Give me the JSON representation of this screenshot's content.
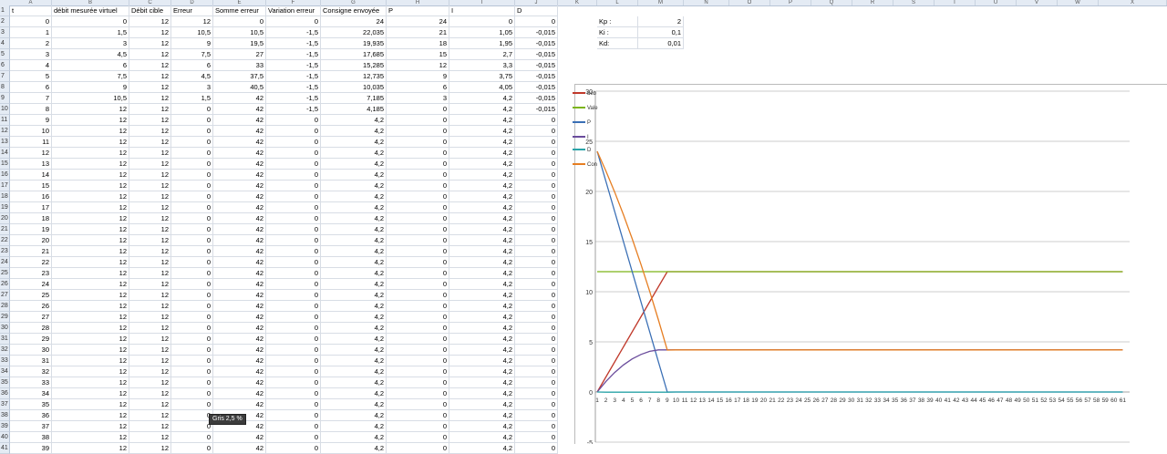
{
  "columns": [
    "A",
    "B",
    "C",
    "D",
    "E",
    "F",
    "G",
    "H",
    "I",
    "J",
    "K",
    "L",
    "M",
    "N",
    "O",
    "P",
    "Q",
    "R",
    "S",
    "T",
    "U",
    "V",
    "W",
    "X"
  ],
  "headers": [
    "t",
    "débit mesurée virtuel",
    "Débit cible",
    "Erreur",
    "Somme erreur",
    "Variation erreur",
    "Consigne envoyée",
    "P",
    "I",
    "D"
  ],
  "params": [
    {
      "label": "Kp :",
      "value": "2"
    },
    {
      "label": "Ki :",
      "value": "0,1"
    },
    {
      "label": "Kd:",
      "value": "0,01"
    }
  ],
  "row_numbers": [
    "1",
    "2",
    "3",
    "4",
    "5",
    "6",
    "7",
    "8",
    "9",
    "10",
    "11",
    "12",
    "13",
    "14",
    "15",
    "16",
    "17",
    "18",
    "19",
    "20",
    "21",
    "22",
    "23",
    "24",
    "25",
    "26",
    "27",
    "28",
    "29",
    "30",
    "31",
    "32",
    "33",
    "34",
    "35",
    "36",
    "37",
    "38",
    "39",
    "40",
    "41"
  ],
  "rows": [
    [
      "0",
      "0",
      "12",
      "12",
      "0",
      "0",
      "24",
      "24",
      "0",
      "0"
    ],
    [
      "1",
      "1,5",
      "12",
      "10,5",
      "10,5",
      "-1,5",
      "22,035",
      "21",
      "1,05",
      "-0,015"
    ],
    [
      "2",
      "3",
      "12",
      "9",
      "19,5",
      "-1,5",
      "19,935",
      "18",
      "1,95",
      "-0,015"
    ],
    [
      "3",
      "4,5",
      "12",
      "7,5",
      "27",
      "-1,5",
      "17,685",
      "15",
      "2,7",
      "-0,015"
    ],
    [
      "4",
      "6",
      "12",
      "6",
      "33",
      "-1,5",
      "15,285",
      "12",
      "3,3",
      "-0,015"
    ],
    [
      "5",
      "7,5",
      "12",
      "4,5",
      "37,5",
      "-1,5",
      "12,735",
      "9",
      "3,75",
      "-0,015"
    ],
    [
      "6",
      "9",
      "12",
      "3",
      "40,5",
      "-1,5",
      "10,035",
      "6",
      "4,05",
      "-0,015"
    ],
    [
      "7",
      "10,5",
      "12",
      "1,5",
      "42",
      "-1,5",
      "7,185",
      "3",
      "4,2",
      "-0,015"
    ],
    [
      "8",
      "12",
      "12",
      "0",
      "42",
      "-1,5",
      "4,185",
      "0",
      "4,2",
      "-0,015"
    ],
    [
      "9",
      "12",
      "12",
      "0",
      "42",
      "0",
      "4,2",
      "0",
      "4,2",
      "0"
    ],
    [
      "10",
      "12",
      "12",
      "0",
      "42",
      "0",
      "4,2",
      "0",
      "4,2",
      "0"
    ],
    [
      "11",
      "12",
      "12",
      "0",
      "42",
      "0",
      "4,2",
      "0",
      "4,2",
      "0"
    ],
    [
      "12",
      "12",
      "12",
      "0",
      "42",
      "0",
      "4,2",
      "0",
      "4,2",
      "0"
    ],
    [
      "13",
      "12",
      "12",
      "0",
      "42",
      "0",
      "4,2",
      "0",
      "4,2",
      "0"
    ],
    [
      "14",
      "12",
      "12",
      "0",
      "42",
      "0",
      "4,2",
      "0",
      "4,2",
      "0"
    ],
    [
      "15",
      "12",
      "12",
      "0",
      "42",
      "0",
      "4,2",
      "0",
      "4,2",
      "0"
    ],
    [
      "16",
      "12",
      "12",
      "0",
      "42",
      "0",
      "4,2",
      "0",
      "4,2",
      "0"
    ],
    [
      "17",
      "12",
      "12",
      "0",
      "42",
      "0",
      "4,2",
      "0",
      "4,2",
      "0"
    ],
    [
      "18",
      "12",
      "12",
      "0",
      "42",
      "0",
      "4,2",
      "0",
      "4,2",
      "0"
    ],
    [
      "19",
      "12",
      "12",
      "0",
      "42",
      "0",
      "4,2",
      "0",
      "4,2",
      "0"
    ],
    [
      "20",
      "12",
      "12",
      "0",
      "42",
      "0",
      "4,2",
      "0",
      "4,2",
      "0"
    ],
    [
      "21",
      "12",
      "12",
      "0",
      "42",
      "0",
      "4,2",
      "0",
      "4,2",
      "0"
    ],
    [
      "22",
      "12",
      "12",
      "0",
      "42",
      "0",
      "4,2",
      "0",
      "4,2",
      "0"
    ],
    [
      "23",
      "12",
      "12",
      "0",
      "42",
      "0",
      "4,2",
      "0",
      "4,2",
      "0"
    ],
    [
      "24",
      "12",
      "12",
      "0",
      "42",
      "0",
      "4,2",
      "0",
      "4,2",
      "0"
    ],
    [
      "25",
      "12",
      "12",
      "0",
      "42",
      "0",
      "4,2",
      "0",
      "4,2",
      "0"
    ],
    [
      "26",
      "12",
      "12",
      "0",
      "42",
      "0",
      "4,2",
      "0",
      "4,2",
      "0"
    ],
    [
      "27",
      "12",
      "12",
      "0",
      "42",
      "0",
      "4,2",
      "0",
      "4,2",
      "0"
    ],
    [
      "28",
      "12",
      "12",
      "0",
      "42",
      "0",
      "4,2",
      "0",
      "4,2",
      "0"
    ],
    [
      "29",
      "12",
      "12",
      "0",
      "42",
      "0",
      "4,2",
      "0",
      "4,2",
      "0"
    ],
    [
      "30",
      "12",
      "12",
      "0",
      "42",
      "0",
      "4,2",
      "0",
      "4,2",
      "0"
    ],
    [
      "31",
      "12",
      "12",
      "0",
      "42",
      "0",
      "4,2",
      "0",
      "4,2",
      "0"
    ],
    [
      "32",
      "12",
      "12",
      "0",
      "42",
      "0",
      "4,2",
      "0",
      "4,2",
      "0"
    ],
    [
      "33",
      "12",
      "12",
      "0",
      "42",
      "0",
      "4,2",
      "0",
      "4,2",
      "0"
    ],
    [
      "34",
      "12",
      "12",
      "0",
      "42",
      "0",
      "4,2",
      "0",
      "4,2",
      "0"
    ],
    [
      "35",
      "12",
      "12",
      "0",
      "42",
      "0",
      "4,2",
      "0",
      "4,2",
      "0"
    ],
    [
      "36",
      "12",
      "12",
      "0",
      "42",
      "0",
      "4,2",
      "0",
      "4,2",
      "0"
    ],
    [
      "37",
      "12",
      "12",
      "0",
      "42",
      "0",
      "4,2",
      "0",
      "4,2",
      "0"
    ],
    [
      "38",
      "12",
      "12",
      "0",
      "42",
      "0",
      "4,2",
      "0",
      "4,2",
      "0"
    ],
    [
      "39",
      "12",
      "12",
      "0",
      "42",
      "0",
      "4,2",
      "0",
      "4,2",
      "0"
    ]
  ],
  "tooltip": "Gris 2,5 %",
  "chart_data": {
    "type": "line",
    "title": "",
    "xlabel": "",
    "ylabel": "",
    "ylim": [
      -5,
      30
    ],
    "yticks": [
      30,
      25,
      20,
      15,
      10,
      5,
      0,
      -5
    ],
    "x": [
      1,
      2,
      3,
      4,
      5,
      6,
      7,
      8,
      9,
      10,
      11,
      12,
      13,
      14,
      15,
      16,
      17,
      18,
      19,
      20,
      21,
      22,
      23,
      24,
      25,
      26,
      27,
      28,
      29,
      30,
      31,
      32,
      33,
      34,
      35,
      36,
      37,
      38,
      39,
      40,
      41,
      42,
      43,
      44,
      45,
      46,
      47,
      48,
      49,
      50,
      51,
      52,
      53,
      54,
      55,
      56,
      57,
      58,
      59,
      60,
      61
    ],
    "grid": true,
    "legend_position": "right",
    "series": [
      {
        "name": "déb",
        "color": "#c0392b",
        "values": [
          0,
          1.5,
          3,
          4.5,
          6,
          7.5,
          9,
          10.5,
          12,
          12,
          12,
          12,
          12,
          12,
          12,
          12,
          12,
          12,
          12,
          12,
          12,
          12,
          12,
          12,
          12,
          12,
          12,
          12,
          12,
          12,
          12,
          12,
          12,
          12,
          12,
          12,
          12,
          12,
          12,
          12,
          12,
          12,
          12,
          12,
          12,
          12,
          12,
          12,
          12,
          12,
          12,
          12,
          12,
          12,
          12,
          12,
          12,
          12,
          12,
          12,
          12
        ]
      },
      {
        "name": "Vale",
        "color": "#7cb518",
        "values": [
          12,
          12,
          12,
          12,
          12,
          12,
          12,
          12,
          12,
          12,
          12,
          12,
          12,
          12,
          12,
          12,
          12,
          12,
          12,
          12,
          12,
          12,
          12,
          12,
          12,
          12,
          12,
          12,
          12,
          12,
          12,
          12,
          12,
          12,
          12,
          12,
          12,
          12,
          12,
          12,
          12,
          12,
          12,
          12,
          12,
          12,
          12,
          12,
          12,
          12,
          12,
          12,
          12,
          12,
          12,
          12,
          12,
          12,
          12,
          12,
          12
        ]
      },
      {
        "name": "P",
        "color": "#3a6fb5",
        "values": [
          24,
          21,
          18,
          15,
          12,
          9,
          6,
          3,
          0,
          0,
          0,
          0,
          0,
          0,
          0,
          0,
          0,
          0,
          0,
          0,
          0,
          0,
          0,
          0,
          0,
          0,
          0,
          0,
          0,
          0,
          0,
          0,
          0,
          0,
          0,
          0,
          0,
          0,
          0,
          0,
          0,
          0,
          0,
          0,
          0,
          0,
          0,
          0,
          0,
          0,
          0,
          0,
          0,
          0,
          0,
          0,
          0,
          0,
          0,
          0,
          0
        ]
      },
      {
        "name": "I",
        "color": "#6a4c9c",
        "values": [
          0,
          1.05,
          1.95,
          2.7,
          3.3,
          3.75,
          4.05,
          4.2,
          4.2,
          4.2,
          4.2,
          4.2,
          4.2,
          4.2,
          4.2,
          4.2,
          4.2,
          4.2,
          4.2,
          4.2,
          4.2,
          4.2,
          4.2,
          4.2,
          4.2,
          4.2,
          4.2,
          4.2,
          4.2,
          4.2,
          4.2,
          4.2,
          4.2,
          4.2,
          4.2,
          4.2,
          4.2,
          4.2,
          4.2,
          4.2,
          4.2,
          4.2,
          4.2,
          4.2,
          4.2,
          4.2,
          4.2,
          4.2,
          4.2,
          4.2,
          4.2,
          4.2,
          4.2,
          4.2,
          4.2,
          4.2,
          4.2,
          4.2,
          4.2,
          4.2,
          4.2
        ]
      },
      {
        "name": "D",
        "color": "#2aa3a8",
        "values": [
          0,
          -0.015,
          -0.015,
          -0.015,
          -0.015,
          -0.015,
          -0.015,
          -0.015,
          -0.015,
          0,
          0,
          0,
          0,
          0,
          0,
          0,
          0,
          0,
          0,
          0,
          0,
          0,
          0,
          0,
          0,
          0,
          0,
          0,
          0,
          0,
          0,
          0,
          0,
          0,
          0,
          0,
          0,
          0,
          0,
          0,
          0,
          0,
          0,
          0,
          0,
          0,
          0,
          0,
          0,
          0,
          0,
          0,
          0,
          0,
          0,
          0,
          0,
          0,
          0,
          0,
          0
        ]
      },
      {
        "name": "Con",
        "color": "#e67e22",
        "values": [
          24,
          22.035,
          19.935,
          17.685,
          15.285,
          12.735,
          10.035,
          7.185,
          4.185,
          4.2,
          4.2,
          4.2,
          4.2,
          4.2,
          4.2,
          4.2,
          4.2,
          4.2,
          4.2,
          4.2,
          4.2,
          4.2,
          4.2,
          4.2,
          4.2,
          4.2,
          4.2,
          4.2,
          4.2,
          4.2,
          4.2,
          4.2,
          4.2,
          4.2,
          4.2,
          4.2,
          4.2,
          4.2,
          4.2,
          4.2,
          4.2,
          4.2,
          4.2,
          4.2,
          4.2,
          4.2,
          4.2,
          4.2,
          4.2,
          4.2,
          4.2,
          4.2,
          4.2,
          4.2,
          4.2,
          4.2,
          4.2,
          4.2,
          4.2,
          4.2,
          4.2
        ]
      }
    ]
  }
}
